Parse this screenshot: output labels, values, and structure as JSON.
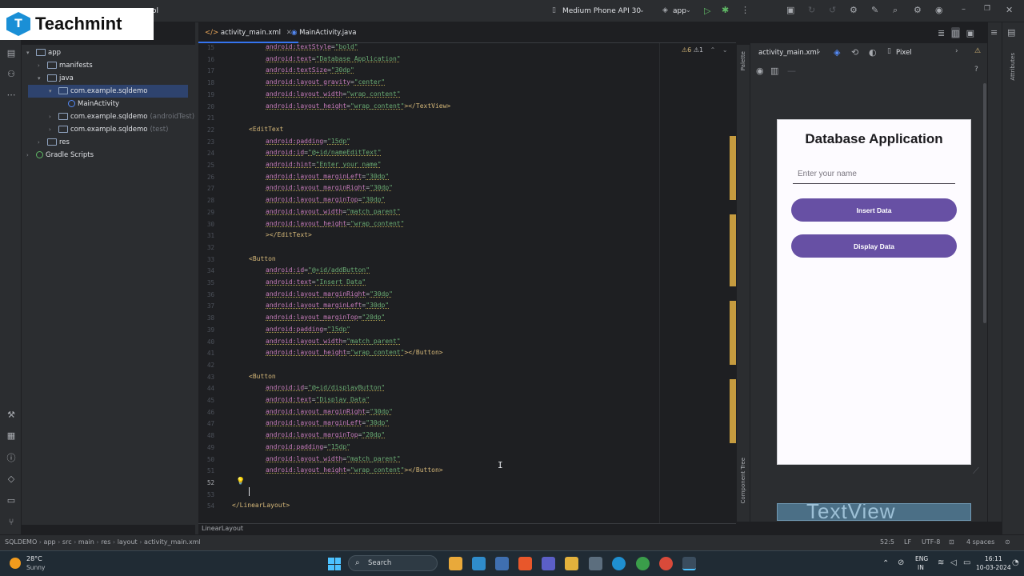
{
  "brand": {
    "logo_text": "Teachmint"
  },
  "titlebar": {
    "project_fragment": "ol",
    "device": "Medium Phone API 30",
    "run_config": "app"
  },
  "project_tree": [
    {
      "label": "app",
      "depth": 0,
      "arrow": "▾",
      "kind": "folder"
    },
    {
      "label": "manifests",
      "depth": 1,
      "arrow": "›",
      "kind": "folder"
    },
    {
      "label": "java",
      "depth": 1,
      "arrow": "▾",
      "kind": "folder"
    },
    {
      "label": "com.example.sqldemo",
      "depth": 2,
      "arrow": "▾",
      "kind": "package",
      "selected": true
    },
    {
      "label": "MainActivity",
      "depth": 3,
      "arrow": "",
      "kind": "class"
    },
    {
      "label": "com.example.sqldemo",
      "suffix": "(androidTest)",
      "depth": 2,
      "arrow": "›",
      "kind": "package"
    },
    {
      "label": "com.example.sqldemo",
      "suffix": "(test)",
      "depth": 2,
      "arrow": "›",
      "kind": "package"
    },
    {
      "label": "res",
      "depth": 1,
      "arrow": "›",
      "kind": "folder"
    },
    {
      "label": "Gradle Scripts",
      "depth": 0,
      "arrow": "›",
      "kind": "gradle"
    }
  ],
  "editor_tabs": [
    {
      "label": "activity_main.xml",
      "active": true
    },
    {
      "label": "MainActivity.java",
      "active": false
    }
  ],
  "inspection": {
    "warnings": "6",
    "weak": "1"
  },
  "code_lines": [
    {
      "n": "15",
      "segs": [
        [
          "a",
          "android:textStyle"
        ],
        [
          "p",
          "="
        ],
        [
          "v",
          "\"bold\""
        ]
      ],
      "indent": 2
    },
    {
      "n": "16",
      "segs": [
        [
          "a",
          "android:text"
        ],
        [
          "p",
          "="
        ],
        [
          "v",
          "\"Database Application\""
        ]
      ],
      "indent": 2
    },
    {
      "n": "17",
      "segs": [
        [
          "a",
          "android:textSize"
        ],
        [
          "p",
          "="
        ],
        [
          "v",
          "\"30dp\""
        ]
      ],
      "indent": 2
    },
    {
      "n": "18",
      "segs": [
        [
          "a",
          "android:layout_gravity"
        ],
        [
          "p",
          "="
        ],
        [
          "v",
          "\"center\""
        ]
      ],
      "indent": 2
    },
    {
      "n": "19",
      "segs": [
        [
          "a",
          "android:layout_width"
        ],
        [
          "p",
          "="
        ],
        [
          "v",
          "\"wrap_content\""
        ]
      ],
      "indent": 2
    },
    {
      "n": "20",
      "segs": [
        [
          "a",
          "android:layout_height"
        ],
        [
          "p",
          "="
        ],
        [
          "v",
          "\"wrap_content\""
        ],
        [
          "t",
          "></TextView>"
        ]
      ],
      "indent": 2
    },
    {
      "n": "21",
      "segs": [],
      "indent": 0
    },
    {
      "n": "22",
      "segs": [
        [
          "t",
          "<EditText"
        ]
      ],
      "indent": 1
    },
    {
      "n": "23",
      "segs": [
        [
          "a",
          "android:padding"
        ],
        [
          "p",
          "="
        ],
        [
          "v",
          "\"15dp\""
        ]
      ],
      "indent": 2
    },
    {
      "n": "24",
      "segs": [
        [
          "a",
          "android:id"
        ],
        [
          "p",
          "="
        ],
        [
          "v",
          "\"@+id/nameEditText\""
        ]
      ],
      "indent": 2
    },
    {
      "n": "25",
      "segs": [
        [
          "a",
          "android:hint"
        ],
        [
          "p",
          "="
        ],
        [
          "v",
          "\"Enter your name\""
        ]
      ],
      "indent": 2
    },
    {
      "n": "26",
      "segs": [
        [
          "a",
          "android:layout_marginLeft"
        ],
        [
          "p",
          "="
        ],
        [
          "v",
          "\"30dp\""
        ]
      ],
      "indent": 2
    },
    {
      "n": "27",
      "segs": [
        [
          "a",
          "android:layout_marginRight"
        ],
        [
          "p",
          "="
        ],
        [
          "v",
          "\"30dp\""
        ]
      ],
      "indent": 2
    },
    {
      "n": "28",
      "segs": [
        [
          "a",
          "android:layout_marginTop"
        ],
        [
          "p",
          "="
        ],
        [
          "v",
          "\"30dp\""
        ]
      ],
      "indent": 2
    },
    {
      "n": "29",
      "segs": [
        [
          "a",
          "android:layout_width"
        ],
        [
          "p",
          "="
        ],
        [
          "v",
          "\"match_parent\""
        ]
      ],
      "indent": 2
    },
    {
      "n": "30",
      "segs": [
        [
          "a",
          "android:layout_height"
        ],
        [
          "p",
          "="
        ],
        [
          "v",
          "\"wrap_content\""
        ]
      ],
      "indent": 2
    },
    {
      "n": "31",
      "segs": [
        [
          "t",
          "></EditText>"
        ]
      ],
      "indent": 2
    },
    {
      "n": "32",
      "segs": [],
      "indent": 0
    },
    {
      "n": "33",
      "segs": [
        [
          "t",
          "<Button"
        ]
      ],
      "indent": 1
    },
    {
      "n": "34",
      "segs": [
        [
          "a",
          "android:id"
        ],
        [
          "p",
          "="
        ],
        [
          "v",
          "\"@+id/addButton\""
        ]
      ],
      "indent": 2
    },
    {
      "n": "35",
      "segs": [
        [
          "a",
          "android:text"
        ],
        [
          "p",
          "="
        ],
        [
          "v",
          "\"Insert Data\""
        ]
      ],
      "indent": 2
    },
    {
      "n": "36",
      "segs": [
        [
          "a",
          "android:layout_marginRight"
        ],
        [
          "p",
          "="
        ],
        [
          "v",
          "\"30dp\""
        ]
      ],
      "indent": 2
    },
    {
      "n": "37",
      "segs": [
        [
          "a",
          "android:layout_marginLeft"
        ],
        [
          "p",
          "="
        ],
        [
          "v",
          "\"30dp\""
        ]
      ],
      "indent": 2
    },
    {
      "n": "38",
      "segs": [
        [
          "a",
          "android:layout_marginTop"
        ],
        [
          "p",
          "="
        ],
        [
          "v",
          "\"20dp\""
        ]
      ],
      "indent": 2
    },
    {
      "n": "39",
      "segs": [
        [
          "a",
          "android:padding"
        ],
        [
          "p",
          "="
        ],
        [
          "v",
          "\"15dp\""
        ]
      ],
      "indent": 2
    },
    {
      "n": "40",
      "segs": [
        [
          "a",
          "android:layout_width"
        ],
        [
          "p",
          "="
        ],
        [
          "v",
          "\"match_parent\""
        ]
      ],
      "indent": 2
    },
    {
      "n": "41",
      "segs": [
        [
          "a",
          "android:layout_height"
        ],
        [
          "p",
          "="
        ],
        [
          "v",
          "\"wrap_content\""
        ],
        [
          "t",
          "></Button>"
        ]
      ],
      "indent": 2
    },
    {
      "n": "42",
      "segs": [],
      "indent": 0
    },
    {
      "n": "43",
      "segs": [
        [
          "t",
          "<Button"
        ]
      ],
      "indent": 1
    },
    {
      "n": "44",
      "segs": [
        [
          "a",
          "android:id"
        ],
        [
          "p",
          "="
        ],
        [
          "v",
          "\"@+id/displayButton\""
        ]
      ],
      "indent": 2
    },
    {
      "n": "45",
      "segs": [
        [
          "a",
          "android:text"
        ],
        [
          "p",
          "="
        ],
        [
          "v",
          "\"Display Data\""
        ]
      ],
      "indent": 2
    },
    {
      "n": "46",
      "segs": [
        [
          "a",
          "android:layout_marginRight"
        ],
        [
          "p",
          "="
        ],
        [
          "v",
          "\"30dp\""
        ]
      ],
      "indent": 2
    },
    {
      "n": "47",
      "segs": [
        [
          "a",
          "android:layout_marginLeft"
        ],
        [
          "p",
          "="
        ],
        [
          "v",
          "\"30dp\""
        ]
      ],
      "indent": 2
    },
    {
      "n": "48",
      "segs": [
        [
          "a",
          "android:layout_marginTop"
        ],
        [
          "p",
          "="
        ],
        [
          "v",
          "\"20dp\""
        ]
      ],
      "indent": 2
    },
    {
      "n": "49",
      "segs": [
        [
          "a",
          "android:padding"
        ],
        [
          "p",
          "="
        ],
        [
          "v",
          "\"15dp\""
        ]
      ],
      "indent": 2
    },
    {
      "n": "50",
      "segs": [
        [
          "a",
          "android:layout_width"
        ],
        [
          "p",
          "="
        ],
        [
          "v",
          "\"match_parent\""
        ]
      ],
      "indent": 2
    },
    {
      "n": "51",
      "segs": [
        [
          "a",
          "android:layout_height"
        ],
        [
          "p",
          "="
        ],
        [
          "v",
          "\"wrap_content\""
        ],
        [
          "t",
          "></Button>"
        ]
      ],
      "indent": 2
    },
    {
      "n": "52",
      "segs": [],
      "indent": 0
    },
    {
      "n": "53",
      "segs": [],
      "indent": 0
    },
    {
      "n": "54",
      "segs": [
        [
          "t",
          "</LinearLayout>"
        ]
      ],
      "indent": 0
    }
  ],
  "editor_footer": {
    "breadcrumb": "LinearLayout"
  },
  "design": {
    "file": "activity_main.xml",
    "device": "Pixel",
    "palette_label": "Palette",
    "component_tree_label": "Component Tree",
    "attributes_label": "Attributes"
  },
  "phone_preview": {
    "title": "Database Application",
    "hint": "Enter your name",
    "button1": "Insert Data",
    "button2": "Display Data",
    "textview_preview": "TextView"
  },
  "statusbar": {
    "crumbs": [
      "SQLDEMO",
      "app",
      "src",
      "main",
      "res",
      "layout",
      "activity_main.xml"
    ],
    "position": "52:5",
    "line_sep": "LF",
    "encoding": "UTF-8",
    "indent": "4 spaces"
  },
  "taskbar": {
    "temp": "28°C",
    "weather": "Sunny",
    "search": "Search",
    "lang1": "ENG",
    "lang2": "IN",
    "time": "16:11",
    "date": "10-03-2024"
  },
  "colors": {
    "accent": "#3574f0",
    "button": "#6750a4",
    "editor_bg": "#1e1f22",
    "panel_bg": "#2b2d30"
  }
}
